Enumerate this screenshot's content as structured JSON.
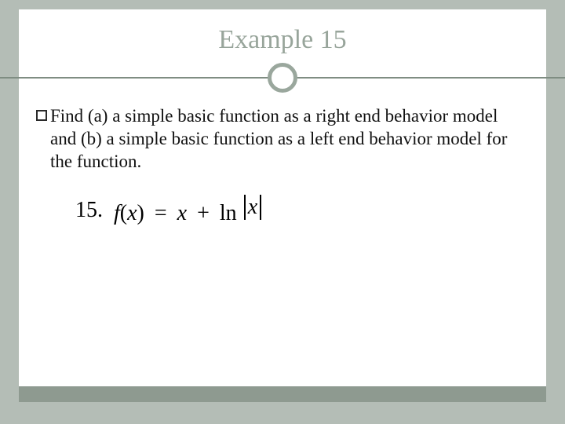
{
  "title": "Example 15",
  "body_text": "Find (a) a simple basic function as a right end behavior model and (b) a simple basic function as a left end behavior model for the function.",
  "equation": {
    "number_label": "15.",
    "lhs_fn": "f",
    "lhs_of": "x",
    "eq": "=",
    "rhs_term1": "x",
    "plus": "+",
    "ln": "ln",
    "abs_arg": "x"
  }
}
